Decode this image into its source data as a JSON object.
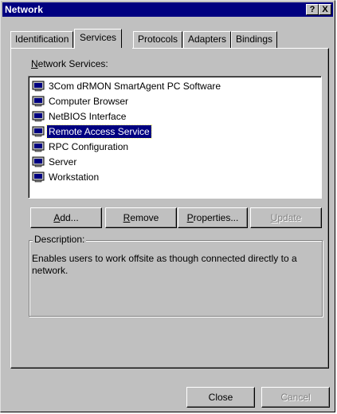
{
  "window": {
    "title": "Network",
    "help_button": "?",
    "close_button": "X"
  },
  "tabs": [
    {
      "label": "Identification",
      "active": false
    },
    {
      "label": "Services",
      "active": true
    },
    {
      "label": "Protocols",
      "active": false
    },
    {
      "label": "Adapters",
      "active": false
    },
    {
      "label": "Bindings",
      "active": false
    }
  ],
  "services": {
    "label": "Network Services:",
    "items": [
      {
        "label": "3Com dRMON SmartAgent PC Software",
        "icon": "computer-icon",
        "selected": false
      },
      {
        "label": "Computer Browser",
        "icon": "computer-icon",
        "selected": false
      },
      {
        "label": "NetBIOS Interface",
        "icon": "computer-icon",
        "selected": false
      },
      {
        "label": "Remote Access Service",
        "icon": "computer-icon",
        "selected": true
      },
      {
        "label": "RPC Configuration",
        "icon": "computer-icon",
        "selected": false
      },
      {
        "label": "Server",
        "icon": "computer-icon",
        "selected": false
      },
      {
        "label": "Workstation",
        "icon": "computer-icon",
        "selected": false
      }
    ]
  },
  "buttons": {
    "add": {
      "label": "Add...",
      "mnemonic": "A",
      "rest": "dd..."
    },
    "remove": {
      "label": "Remove",
      "mnemonic": "R",
      "rest": "emove"
    },
    "properties": {
      "label": "Properties...",
      "mnemonic": "P",
      "rest": "roperties..."
    },
    "update": {
      "label": "Update",
      "mnemonic": "U",
      "rest": "pdate",
      "disabled": true
    }
  },
  "description": {
    "label": "Description:",
    "text": "Enables users to work offsite as though connected directly to a network."
  },
  "footer": {
    "close": "Close",
    "cancel": "Cancel"
  },
  "colors": {
    "face": "#c0c0c0",
    "titlebar": "#000080",
    "selection": "#000080"
  }
}
